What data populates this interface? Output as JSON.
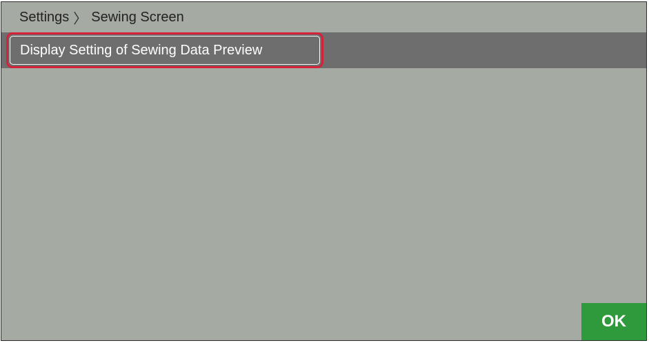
{
  "header": {
    "breadcrumb": {
      "parent": "Settings",
      "separator": "〉",
      "current": "Sewing Screen"
    }
  },
  "menu": {
    "items": [
      {
        "label": "Display Setting of Sewing Data Preview",
        "highlighted": true
      }
    ]
  },
  "footer": {
    "ok_label": "OK"
  },
  "colors": {
    "background": "#a5aaa3",
    "item_bar": "#6e6e6e",
    "highlight_border": "#d5213a",
    "ok_button": "#2f9a3c"
  }
}
